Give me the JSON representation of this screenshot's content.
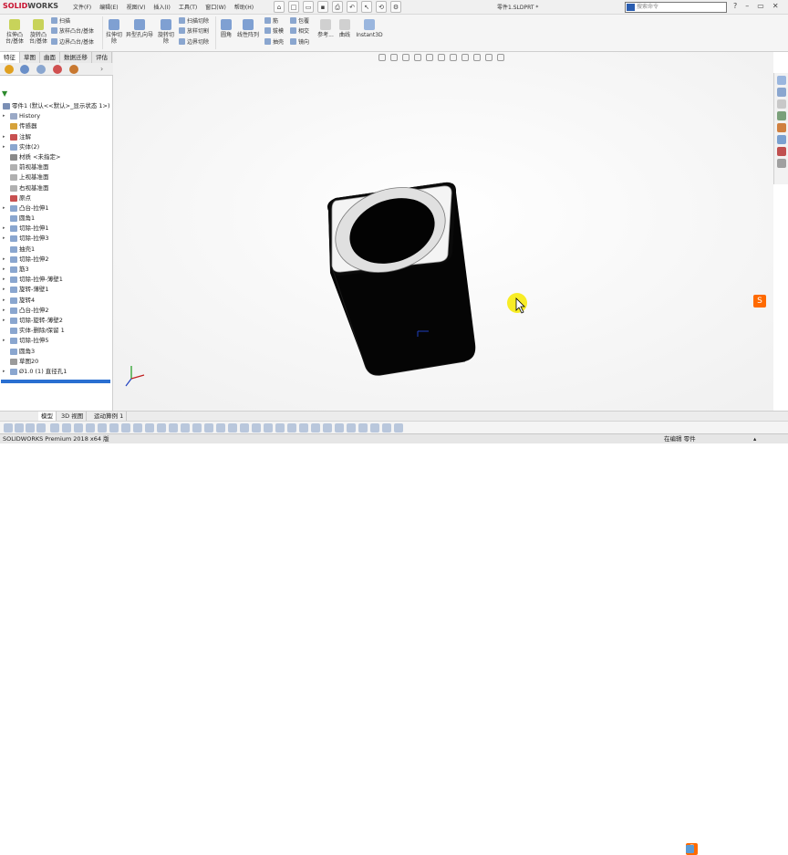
{
  "titlebar": {
    "logo_brand": "SOLID",
    "logo_rest": "WORKS",
    "menu": [
      "文件(F)",
      "编辑(E)",
      "视图(V)",
      "插入(I)",
      "工具(T)",
      "窗口(W)",
      "帮助(H)"
    ],
    "document": "零件1.SLDPRT *",
    "search_placeholder": "搜索命令",
    "window_buttons": [
      "?",
      "–",
      "▭",
      "✕"
    ]
  },
  "ribbon": {
    "big_buttons": [
      "拉伸凸台/基体",
      "旋转凸台/基体",
      "拉伸切除",
      "异型孔向导",
      "旋转切除",
      "圆角",
      "线性阵列",
      "参考...",
      "曲线",
      "Instant3D"
    ],
    "small_buttons": [
      "扫描",
      "放样凸台/基体",
      "边界凸台/基体",
      "扫描切除",
      "放样切割",
      "边界切除",
      "筋",
      "包覆",
      "拔模",
      "相交",
      "抽壳",
      "镜向"
    ]
  },
  "command_tabs": [
    "特征",
    "草图",
    "曲面",
    "数据迁移",
    "评估"
  ],
  "feature_tree": [
    {
      "label": "零件1  (默认<<默认>_显示状态 1>)",
      "indent": 0,
      "arrow": "",
      "icon": "#7b8fb5"
    },
    {
      "label": "History",
      "indent": 1,
      "arrow": "▸",
      "icon": "#9aa9c6"
    },
    {
      "label": "传感器",
      "indent": 1,
      "arrow": "",
      "icon": "#d6a23a"
    },
    {
      "label": "注解",
      "indent": 1,
      "arrow": "▸",
      "icon": "#c85050"
    },
    {
      "label": "实体(2)",
      "indent": 1,
      "arrow": "▸",
      "icon": "#8aa6cf"
    },
    {
      "label": "材质 <未指定>",
      "indent": 1,
      "arrow": "",
      "icon": "#8a8a8a"
    },
    {
      "label": "前视基准面",
      "indent": 1,
      "arrow": "",
      "icon": "#b0b0b0"
    },
    {
      "label": "上视基准面",
      "indent": 1,
      "arrow": "",
      "icon": "#b0b0b0"
    },
    {
      "label": "右视基准面",
      "indent": 1,
      "arrow": "",
      "icon": "#b0b0b0"
    },
    {
      "label": "原点",
      "indent": 1,
      "arrow": "",
      "icon": "#c85050"
    },
    {
      "label": "凸台-拉伸1",
      "indent": 1,
      "arrow": "▸",
      "icon": "#8aa6cf"
    },
    {
      "label": "圆角1",
      "indent": 1,
      "arrow": "",
      "icon": "#8aa6cf"
    },
    {
      "label": "切除-拉伸1",
      "indent": 1,
      "arrow": "▸",
      "icon": "#8aa6cf"
    },
    {
      "label": "切除-拉伸3",
      "indent": 1,
      "arrow": "▸",
      "icon": "#8aa6cf"
    },
    {
      "label": "抽壳1",
      "indent": 1,
      "arrow": "",
      "icon": "#8aa6cf"
    },
    {
      "label": "切除-拉伸2",
      "indent": 1,
      "arrow": "▸",
      "icon": "#8aa6cf"
    },
    {
      "label": "筋3",
      "indent": 1,
      "arrow": "▸",
      "icon": "#8aa6cf"
    },
    {
      "label": "切除-拉伸-薄壁1",
      "indent": 1,
      "arrow": "▸",
      "icon": "#8aa6cf"
    },
    {
      "label": "旋转-薄壁1",
      "indent": 1,
      "arrow": "▸",
      "icon": "#8aa6cf"
    },
    {
      "label": "旋转4",
      "indent": 1,
      "arrow": "▸",
      "icon": "#8aa6cf"
    },
    {
      "label": "凸台-拉伸2",
      "indent": 1,
      "arrow": "▸",
      "icon": "#8aa6cf"
    },
    {
      "label": "切除-旋转-薄壁2",
      "indent": 1,
      "arrow": "▸",
      "icon": "#8aa6cf"
    },
    {
      "label": "实体-删除/保留 1",
      "indent": 1,
      "arrow": "",
      "icon": "#8aa6cf"
    },
    {
      "label": "切除-拉伸5",
      "indent": 1,
      "arrow": "▸",
      "icon": "#8aa6cf"
    },
    {
      "label": "圆角3",
      "indent": 1,
      "arrow": "",
      "icon": "#8aa6cf"
    },
    {
      "label": "草图20",
      "indent": 1,
      "arrow": "",
      "icon": "#9a9a9a"
    },
    {
      "label": "Ø1.0 (1) 直径孔1",
      "indent": 1,
      "arrow": "▸",
      "icon": "#8aa6cf"
    }
  ],
  "bottom_tabs": [
    "模型",
    "3D 视图",
    "运动算例 1"
  ],
  "status": {
    "left": "SOLIDWORKS Premium 2018 x64 版",
    "right": "在编辑  零件",
    "app_tag": "S"
  },
  "colors": {
    "accent": "#2a6fd1",
    "brand": "#c8102e",
    "cursor": "#f7ea00"
  }
}
